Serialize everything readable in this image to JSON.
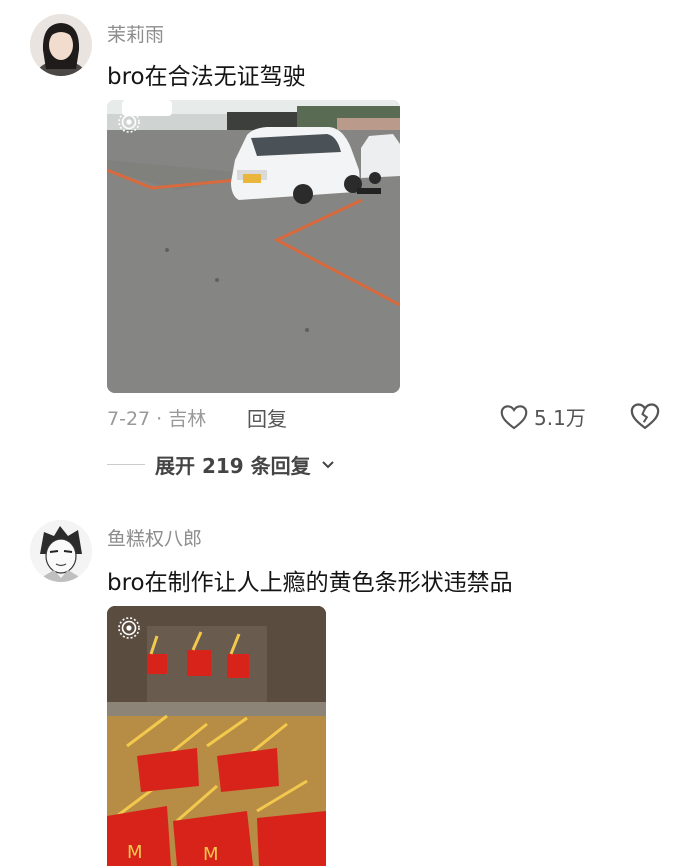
{
  "comments": [
    {
      "username": "茉莉雨",
      "text": "bro在合法无证驾驶",
      "meta": "7-27 · 吉林",
      "reply_label": "回复",
      "likes": "5.1万",
      "expand_label": "展开 219 条回复"
    },
    {
      "username": "鱼糕权八郎",
      "text": "bro在制作让人上瘾的黄色条形状违禁品"
    }
  ],
  "icons": {
    "live_photo": "live-photo-icon",
    "like": "heart-icon",
    "dislike": "broken-heart-icon",
    "expand": "chevron-down-icon"
  }
}
